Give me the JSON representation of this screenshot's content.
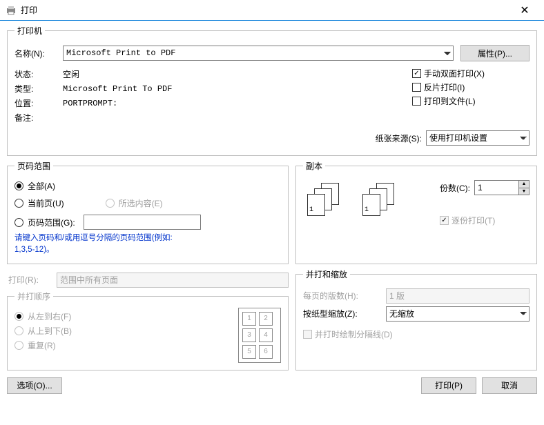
{
  "title": "打印",
  "printer": {
    "legend": "打印机",
    "name_label": "名称(N):",
    "name_value": "Microsoft Print to PDF",
    "properties_btn": "属性(P)...",
    "status_label": "状态:",
    "status_value": "空闲",
    "type_label": "类型:",
    "type_value": "Microsoft Print To PDF",
    "where_label": "位置:",
    "where_value": "PORTPROMPT:",
    "comment_label": "备注:",
    "comment_value": "",
    "duplex_label": "手动双面打印(X)",
    "mirror_label": "反片打印(I)",
    "tofile_label": "打印到文件(L)",
    "source_label": "纸张来源(S):",
    "source_value": "使用打印机设置"
  },
  "range": {
    "legend": "页码范围",
    "all": "全部(A)",
    "current": "当前页(U)",
    "selection": "所选内容(E)",
    "pages": "页码范围(G):",
    "pages_value": "",
    "hint": "请键入页码和/或用逗号分隔的页码范围(例如:\n1,3,5-12)。"
  },
  "copies": {
    "legend": "副本",
    "count_label": "份数(C):",
    "count_value": "1",
    "collate_label": "逐份打印(T)"
  },
  "printwhat": {
    "label": "打印(R):",
    "value": "范围中所有页面"
  },
  "order": {
    "legend": "并打顺序",
    "lr": "从左到右(F)",
    "tb": "从上到下(B)",
    "repeat": "重复(R)"
  },
  "zoom": {
    "legend": "并打和缩放",
    "perpage_label": "每页的版数(H):",
    "perpage_value": "1 版",
    "scale_label": "按纸型缩放(Z):",
    "scale_value": "无缩放",
    "divider_label": "并打时绘制分隔线(D)"
  },
  "buttons": {
    "options": "选项(O)...",
    "print": "打印(P)",
    "cancel": "取消"
  }
}
